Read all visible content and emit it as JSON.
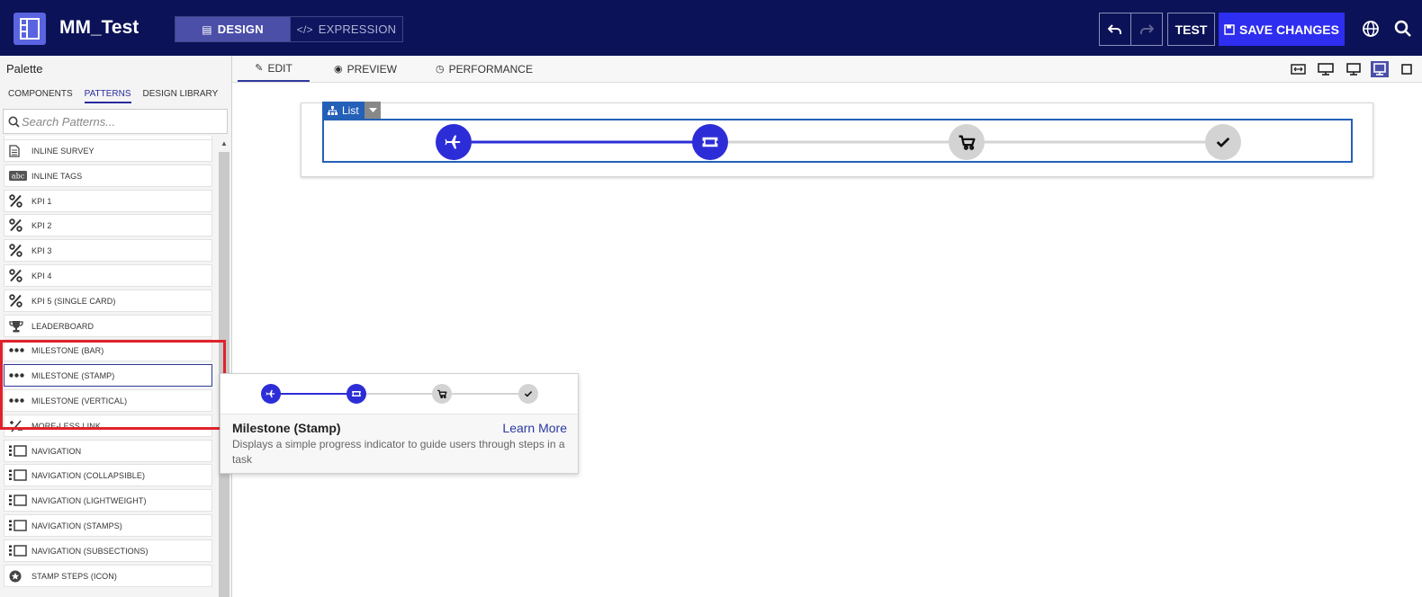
{
  "header": {
    "app_title": "MM_Test",
    "mode_design": "DESIGN",
    "mode_expression": "EXPRESSION",
    "test_label": "TEST",
    "save_label": "SAVE CHANGES"
  },
  "palette": {
    "title": "Palette",
    "tabs": [
      "COMPONENTS",
      "PATTERNS",
      "DESIGN LIBRARY"
    ],
    "active_tab": "PATTERNS",
    "search_placeholder": "Search Patterns...",
    "items": [
      {
        "label": "INLINE SURVEY",
        "icon": "document-icon"
      },
      {
        "label": "INLINE TAGS",
        "icon": "abc-icon"
      },
      {
        "label": "KPI 1",
        "icon": "percent-icon"
      },
      {
        "label": "KPI 2",
        "icon": "percent-icon"
      },
      {
        "label": "KPI 3",
        "icon": "percent-icon"
      },
      {
        "label": "KPI 4",
        "icon": "percent-icon"
      },
      {
        "label": "KPI 5 (SINGLE CARD)",
        "icon": "percent-icon"
      },
      {
        "label": "LEADERBOARD",
        "icon": "trophy-icon"
      },
      {
        "label": "MILESTONE (BAR)",
        "icon": "dots-icon"
      },
      {
        "label": "MILESTONE (STAMP)",
        "icon": "dots-icon"
      },
      {
        "label": "MILESTONE (VERTICAL)",
        "icon": "dots-icon"
      },
      {
        "label": "MORE-LESS LINK",
        "icon": "more-less-icon"
      },
      {
        "label": "NAVIGATION",
        "icon": "navigation-icon"
      },
      {
        "label": "NAVIGATION (COLLAPSIBLE)",
        "icon": "navigation-icon"
      },
      {
        "label": "NAVIGATION (LIGHTWEIGHT)",
        "icon": "navigation-icon"
      },
      {
        "label": "NAVIGATION (STAMPS)",
        "icon": "navigation-icon"
      },
      {
        "label": "NAVIGATION (SUBSECTIONS)",
        "icon": "navigation-icon"
      },
      {
        "label": "STAMP STEPS (ICON)",
        "icon": "star-circle-icon"
      }
    ]
  },
  "canvas": {
    "tabs": [
      "EDIT",
      "PREVIEW",
      "PERFORMANCE"
    ],
    "active_tab": "EDIT",
    "list_tag": "List"
  },
  "tooltip": {
    "title": "Milestone (Stamp)",
    "learn_more": "Learn More",
    "description": "Displays a simple progress indicator to guide users through steps in a task"
  },
  "colors": {
    "header_bg": "#0b1257",
    "accent": "#2e2ef0",
    "milestone_active": "#2d2dd8",
    "milestone_inactive": "#d3d3d3",
    "highlight_red": "#e0222b"
  },
  "milestone": {
    "steps": [
      "airplane-icon",
      "ticket-icon",
      "cart-icon",
      "check-icon"
    ],
    "completed_steps": 2
  }
}
